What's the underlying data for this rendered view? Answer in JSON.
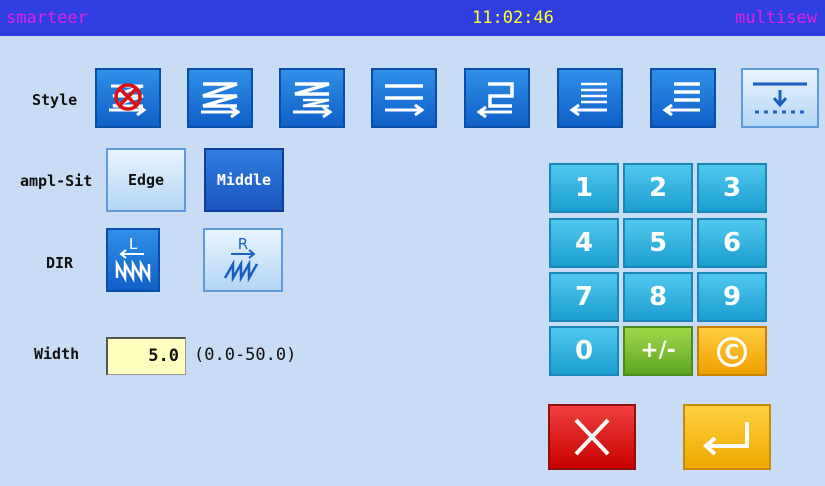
{
  "titlebar": {
    "brand": "smarteer",
    "time": "11:02:46",
    "mode": "multisew"
  },
  "style": {
    "label": "Style",
    "buttons": [
      {
        "icon": "no-sew-icon",
        "selected": false
      },
      {
        "icon": "zigzag-single-icon",
        "selected": false
      },
      {
        "icon": "zigzag-double-icon",
        "selected": false
      },
      {
        "icon": "straight-lines-icon",
        "selected": false
      },
      {
        "icon": "backtack-return-icon",
        "selected": false
      },
      {
        "icon": "backtack-multi-icon",
        "selected": false
      },
      {
        "icon": "backtack-triple-icon",
        "selected": false
      },
      {
        "icon": "dotted-drop-icon",
        "selected": true
      }
    ]
  },
  "sampling": {
    "label": "ampl-Sit",
    "options": [
      "Edge",
      "Middle"
    ],
    "selected": "Edge"
  },
  "dir": {
    "label": "DIR",
    "left_letter": "L",
    "right_letter": "R",
    "selected": "L"
  },
  "width": {
    "label": "Width",
    "value": "5.0",
    "range": "(0.0-50.0)"
  },
  "keypad": {
    "keys": [
      "1",
      "2",
      "3",
      "4",
      "5",
      "6",
      "7",
      "8",
      "9",
      "0",
      "+/-",
      "C"
    ]
  },
  "colors": {
    "titlebar": "#2f3ee0",
    "background": "#c9dcf5",
    "time": "#ffff33",
    "brand": "#e020e0"
  }
}
